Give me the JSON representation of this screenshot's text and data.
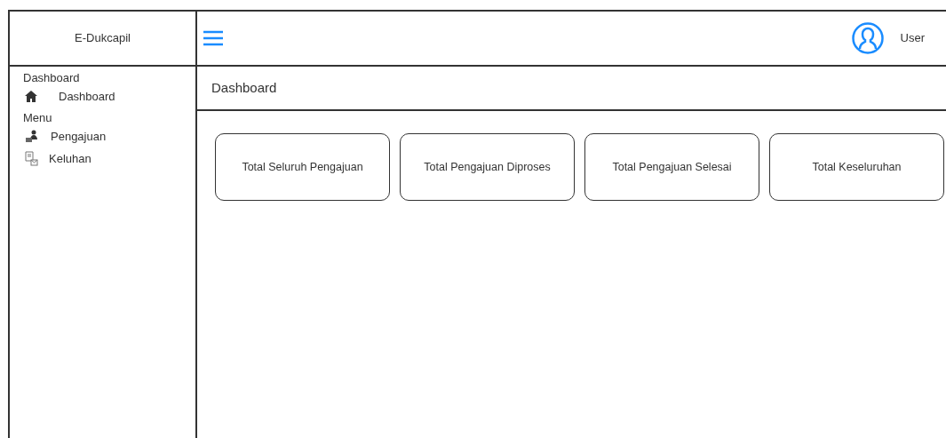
{
  "brand": "E-Dukcapil",
  "user": {
    "name": "User"
  },
  "sidebar": {
    "sections": [
      {
        "title": "Dashboard",
        "items": [
          {
            "label": "Dashboard",
            "kind": "home"
          }
        ]
      },
      {
        "title": "Menu",
        "items": [
          {
            "label": "Pengajuan",
            "kind": "people"
          },
          {
            "label": "Keluhan",
            "kind": "document"
          }
        ]
      }
    ]
  },
  "page_title": "Dashboard",
  "cards": [
    "Total Seluruh Pengajuan",
    "Total Pengajuan Diproses",
    "Total Pengajuan Selesai",
    "Total Keseluruhan"
  ]
}
